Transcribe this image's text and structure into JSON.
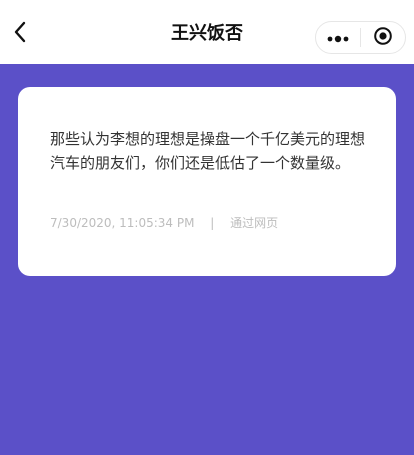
{
  "nav": {
    "title": "王兴饭否",
    "back_icon": "chevron-left-icon",
    "more_icon": "more-dots-icon",
    "close_icon": "target-circle-icon"
  },
  "post": {
    "text": "那些认为李想的理想是操盘一个千亿美元的理想汽车的朋友们，你们还是低估了一个数量级。",
    "timestamp": "7/30/2020, 11:05:34 PM",
    "separator": "|",
    "source": "通过网页"
  },
  "colors": {
    "background": "#5b50c8",
    "card": "#ffffff",
    "text": "#333333",
    "meta": "#bdbdbd"
  }
}
